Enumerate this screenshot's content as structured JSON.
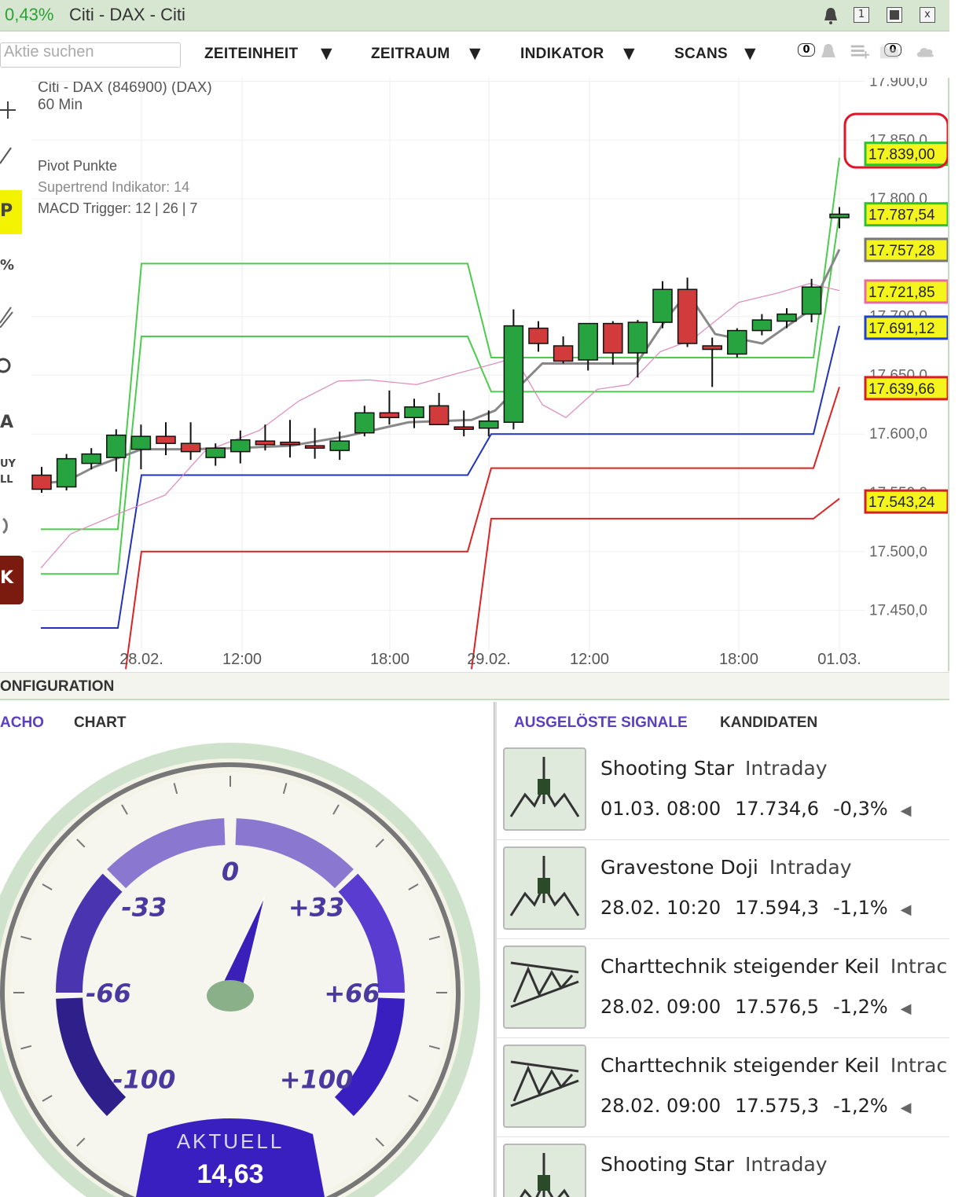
{
  "titlebar": {
    "change": "0,43%",
    "title": "Citi - DAX - Citi",
    "buttons": [
      "1",
      "x"
    ]
  },
  "toolbar": {
    "search_placeholder": "Aktie suchen",
    "menus": [
      "ZEITEINHEIT",
      "ZEITRAUM",
      "INDIKATOR",
      "SCANS"
    ],
    "badge_left": "0",
    "badge_right": "0"
  },
  "chart": {
    "instrument": "Citi - DAX (846900) (DAX)",
    "interval": "60 Min",
    "indicators": [
      "Pivot Punkte",
      "Supertrend Indikator: 14",
      "MACD Trigger: 12 | 26 | 7"
    ],
    "left_tools": [
      "P",
      "%",
      "A",
      "UY",
      "LL",
      "K"
    ]
  },
  "chart_data": {
    "type": "candlestick",
    "x_ticks": [
      "28.02.",
      "12:00",
      "18:00",
      "29.02.",
      "12:00",
      "18:00",
      "01.03."
    ],
    "y_ticks": [
      "17.900,0",
      "17.850,0",
      "17.800,0",
      "17.700,0",
      "17.650,0",
      "17.600,0",
      "17.550,0",
      "17.500,0",
      "17.450,0"
    ],
    "ylim": [
      17435,
      17903
    ],
    "price_labels": [
      {
        "text": "17.839,00",
        "value": 17839,
        "color": "#f5f51e",
        "border": "#2fc22f"
      },
      {
        "text": "17.787,54",
        "value": 17787.54,
        "color": "#f5f51e",
        "border": "#2fc22f"
      },
      {
        "text": "17.757,28",
        "value": 17757.28,
        "color": "#f5f51e",
        "border": "#777777"
      },
      {
        "text": "17.721,85",
        "value": 17721.85,
        "color": "#f5f51e",
        "border": "#e86aa0"
      },
      {
        "text": "17.691,12",
        "value": 17691.12,
        "color": "#f5f51e",
        "border": "#1f3fd6"
      },
      {
        "text": "17.639,66",
        "value": 17639.66,
        "color": "#f5f51e",
        "border": "#d62020"
      },
      {
        "text": "17.543,24",
        "value": 17543.24,
        "color": "#f5f51e",
        "border": "#d62020"
      }
    ],
    "candles": [
      [
        17565,
        17572,
        17550,
        17553
      ],
      [
        17555,
        17583,
        17552,
        17579
      ],
      [
        17575,
        17588,
        17570,
        17583
      ],
      [
        17580,
        17604,
        17568,
        17599
      ],
      [
        17587,
        17608,
        17570,
        17598
      ],
      [
        17598,
        17610,
        17582,
        17592
      ],
      [
        17592,
        17610,
        17578,
        17585
      ],
      [
        17580,
        17592,
        17573,
        17588
      ],
      [
        17585,
        17603,
        17575,
        17595
      ],
      [
        17594,
        17608,
        17586,
        17591
      ],
      [
        17593,
        17612,
        17580,
        17592
      ],
      [
        17590,
        17605,
        17579,
        17588
      ],
      [
        17586,
        17602,
        17578,
        17594
      ],
      [
        17601,
        17624,
        17598,
        17618
      ],
      [
        17618,
        17637,
        17608,
        17614
      ],
      [
        17614,
        17630,
        17605,
        17623
      ],
      [
        17624,
        17635,
        17615,
        17608
      ],
      [
        17606,
        17620,
        17598,
        17604
      ],
      [
        17605,
        17620,
        17598,
        17611
      ],
      [
        17610,
        17706,
        17604,
        17692
      ],
      [
        17690,
        17696,
        17670,
        17677
      ],
      [
        17675,
        17683,
        17660,
        17662
      ],
      [
        17663,
        17694,
        17654,
        17694
      ],
      [
        17694,
        17696,
        17659,
        17669
      ],
      [
        17669,
        17697,
        17648,
        17695
      ],
      [
        17695,
        17730,
        17690,
        17723
      ],
      [
        17723,
        17733,
        17674,
        17677
      ],
      [
        17675,
        17682,
        17640,
        17672
      ],
      [
        17668,
        17690,
        17665,
        17688
      ],
      [
        17688,
        17702,
        17684,
        17697
      ],
      [
        17696,
        17707,
        17690,
        17702
      ],
      [
        17702,
        17732,
        17695,
        17725
      ],
      [
        17784,
        17793,
        17775,
        17787
      ]
    ]
  },
  "config": {
    "label": "ONFIGURATION"
  },
  "tabs": {
    "tacho": "ACHO",
    "chart": "CHART",
    "signals": "AUSGELÖSTE SIGNALE",
    "candidates": "KANDIDATEN"
  },
  "gauge": {
    "labels": [
      "-100",
      "-66",
      "-33",
      "0",
      "+33",
      "+66",
      "+100"
    ],
    "current_label": "AKTUELL",
    "current_value": "14,63",
    "value": 14.63
  },
  "signals": [
    {
      "name": "Shooting Star",
      "type": "Intraday",
      "date": "01.03. 08:00",
      "price": "17.734,6",
      "change": "-0,3%",
      "icon": "candle-pattern-icon"
    },
    {
      "name": "Gravestone Doji",
      "type": "Intraday",
      "date": "28.02. 10:20",
      "price": "17.594,3",
      "change": "-1,1%",
      "icon": "candle-pattern-icon"
    },
    {
      "name": "Charttechnik steigender Keil",
      "type": "Intrac",
      "date": "28.02. 09:00",
      "price": "17.576,5",
      "change": "-1,2%",
      "icon": "wedge-pattern-icon"
    },
    {
      "name": "Charttechnik steigender Keil",
      "type": "Intrac",
      "date": "28.02. 09:00",
      "price": "17.575,3",
      "change": "-1,2%",
      "icon": "wedge-pattern-icon"
    },
    {
      "name": "Shooting Star",
      "type": "Intraday",
      "date": "",
      "price": "",
      "change": "",
      "icon": "candle-pattern-icon"
    }
  ]
}
